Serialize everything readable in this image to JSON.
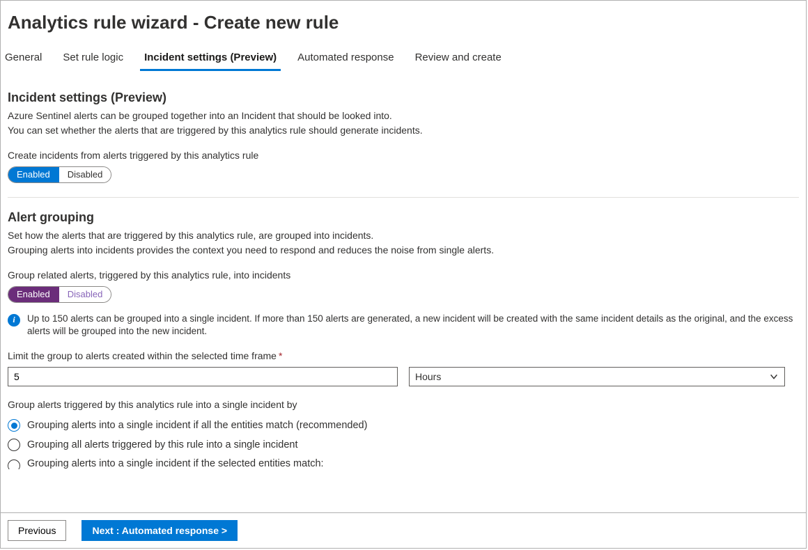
{
  "title": "Analytics rule wizard - Create new rule",
  "tabs": {
    "t0": "General",
    "t1": "Set rule logic",
    "t2": "Incident settings (Preview)",
    "t3": "Automated response",
    "t4": "Review and create",
    "active_index": 2
  },
  "incident_settings": {
    "heading": "Incident settings (Preview)",
    "desc1": "Azure Sentinel alerts can be grouped together into an Incident that should be looked into.",
    "desc2": "You can set whether the alerts that are triggered by this analytics rule should generate incidents.",
    "create_label": "Create incidents from alerts triggered by this analytics rule",
    "toggle": {
      "on": "Enabled",
      "off": "Disabled",
      "value": "Enabled"
    }
  },
  "alert_grouping": {
    "heading": "Alert grouping",
    "desc1": "Set how the alerts that are triggered by this analytics rule, are grouped into incidents.",
    "desc2": "Grouping alerts into incidents provides the context you need to respond and reduces the noise from single alerts.",
    "group_label": "Group related alerts, triggered by this analytics rule, into incidents",
    "toggle": {
      "on": "Enabled",
      "off": "Disabled",
      "value": "Enabled"
    },
    "info": "Up to 150 alerts can be grouped into a single incident. If more than 150 alerts are generated, a new incident will be created with the same incident details as the original, and the excess alerts will be grouped into the new incident.",
    "limit_label": "Limit the group to alerts created within the selected time frame",
    "limit_value": "5",
    "limit_unit": "Hours",
    "group_by_label": "Group alerts triggered by this analytics rule into a single incident by",
    "radio_options": {
      "r0": "Grouping alerts into a single incident if all the entities match (recommended)",
      "r1": "Grouping all alerts triggered by this rule into a single incident",
      "r2": "Grouping alerts into a single incident if the selected entities match:",
      "selected_index": 0
    }
  },
  "footer": {
    "previous": "Previous",
    "next": "Next : Automated response >"
  }
}
